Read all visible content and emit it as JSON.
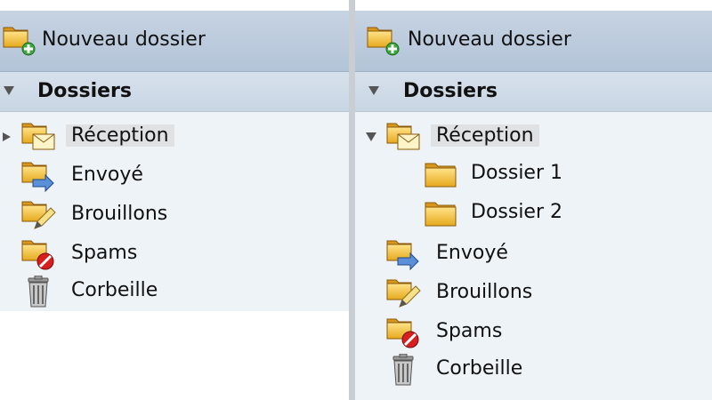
{
  "left_panel": {
    "toolbar": {
      "new_folder_label": "Nouveau dossier"
    },
    "header": {
      "title": "Dossiers"
    },
    "folders": [
      {
        "label": "Réception",
        "icon": "inbox-folder-icon",
        "expander": "collapsed",
        "selected": true
      },
      {
        "label": "Envoyé",
        "icon": "sent-folder-icon"
      },
      {
        "label": "Brouillons",
        "icon": "drafts-folder-icon"
      },
      {
        "label": "Spams",
        "icon": "spam-folder-icon"
      },
      {
        "label": "Corbeille",
        "icon": "trash-icon"
      }
    ]
  },
  "right_panel": {
    "toolbar": {
      "new_folder_label": "Nouveau dossier"
    },
    "header": {
      "title": "Dossiers"
    },
    "folders": [
      {
        "label": "Réception",
        "icon": "inbox-folder-icon",
        "expander": "expanded",
        "selected": true,
        "children": [
          {
            "label": "Dossier 1",
            "icon": "folder-icon"
          },
          {
            "label": "Dossier 2",
            "icon": "folder-icon"
          }
        ]
      },
      {
        "label": "Envoyé",
        "icon": "sent-folder-icon"
      },
      {
        "label": "Brouillons",
        "icon": "drafts-folder-icon"
      },
      {
        "label": "Spams",
        "icon": "spam-folder-icon"
      },
      {
        "label": "Corbeille",
        "icon": "trash-icon"
      }
    ]
  },
  "colors": {
    "toolbar_bg": "#b9c9dc",
    "header_bg": "#cfdae7",
    "tree_bg": "#eef3f8",
    "selection_bg": "#dfe1e3",
    "folder_yellow": "#f5c842"
  }
}
